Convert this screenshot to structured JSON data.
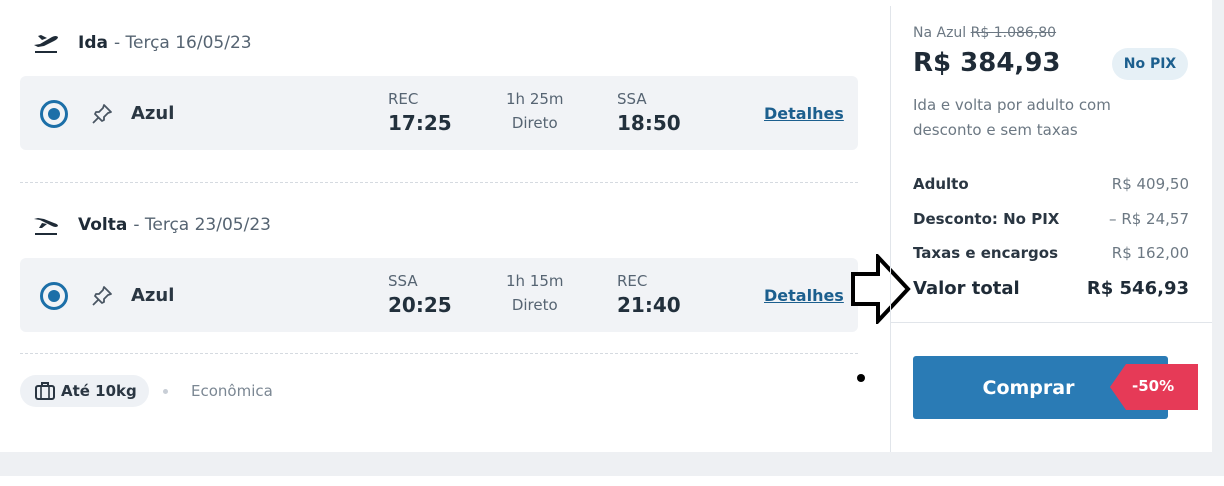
{
  "outbound": {
    "direction": "Ida",
    "date": "- Terça 16/05/23",
    "airline": "Azul",
    "origin_code": "REC",
    "depart_time": "17:25",
    "duration": "1h 25m",
    "stops": "Direto",
    "dest_code": "SSA",
    "arrive_time": "18:50",
    "details_link": "Detalhes"
  },
  "inbound": {
    "direction": "Volta",
    "date": "- Terça 23/05/23",
    "airline": "Azul",
    "origin_code": "SSA",
    "depart_time": "20:25",
    "duration": "1h 15m",
    "stops": "Direto",
    "dest_code": "REC",
    "arrive_time": "21:40",
    "details_link": "Detalhes"
  },
  "extras": {
    "baggage": "Até 10kg",
    "cabin": "Econômica"
  },
  "summary": {
    "airline_prefix": "Na Azul",
    "original_price": "R$ 1.086,80",
    "price": "R$ 384,93",
    "pix_badge": "No PIX",
    "description": "Ida e volta por adulto com desconto e sem taxas",
    "lines": [
      {
        "label": "Adulto",
        "value": "R$ 409,50"
      },
      {
        "label": "Desconto: No PIX",
        "value": "– R$ 24,57"
      },
      {
        "label": "Taxas e encargos",
        "value": "R$ 162,00"
      }
    ],
    "total_label": "Valor total",
    "total_value": "R$ 546,93",
    "buy_label": "Comprar",
    "discount_tag": "-50%"
  },
  "colors": {
    "accent": "#2a7bb5",
    "discount": "#e63a57",
    "row_bg": "#f1f3f6"
  }
}
